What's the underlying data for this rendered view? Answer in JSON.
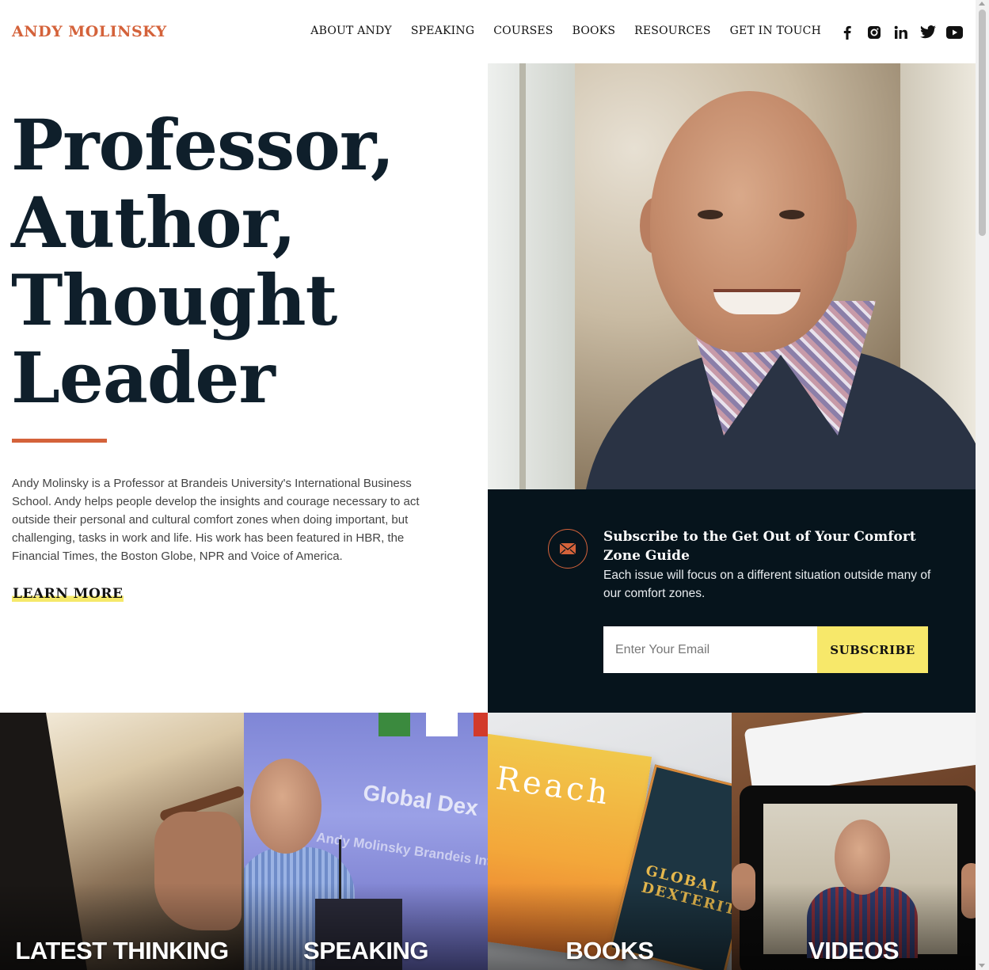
{
  "brand": {
    "logo": "ANDY MOLINSKY"
  },
  "nav": [
    {
      "label": "ABOUT ANDY"
    },
    {
      "label": "SPEAKING"
    },
    {
      "label": "COURSES"
    },
    {
      "label": "BOOKS"
    },
    {
      "label": "RESOURCES"
    },
    {
      "label": "GET IN TOUCH"
    }
  ],
  "social": [
    "facebook-icon",
    "instagram-icon",
    "linkedin-icon",
    "twitter-icon",
    "youtube-icon"
  ],
  "hero": {
    "headline": [
      "Professor,",
      "Author,",
      "Thought",
      "Leader"
    ],
    "bio": "Andy Molinsky is a Professor at Brandeis University's International Business School. Andy helps people develop the insights and courage necessary to act outside their personal and cultural comfort zones when doing important, but challenging, tasks in work and life. His work has been featured in HBR, the Financial Times, the Boston Globe, NPR and Voice of America.",
    "cta": "LEARN MORE"
  },
  "subscribe": {
    "title": "Subscribe to the Get Out of Your Comfort Zone Guide",
    "description": "Each issue will focus on a different situation outside many of our comfort zones.",
    "email_placeholder": "Enter Your Email",
    "button_label": "SUBSCRIBE"
  },
  "tiles": [
    {
      "label": "LATEST THINKING"
    },
    {
      "label": "SPEAKING",
      "screen_text": "Global Dex",
      "screen_sub": "Andy Molinsky Brandeis International B"
    },
    {
      "label": "BOOKS",
      "book1": "Reach",
      "book2": "GLOBAL DEXTERITY"
    },
    {
      "label": "VIDEOS"
    }
  ],
  "colors": {
    "accent": "#d4623a",
    "dark_panel": "#06141c",
    "highlight": "#f7e86a"
  }
}
